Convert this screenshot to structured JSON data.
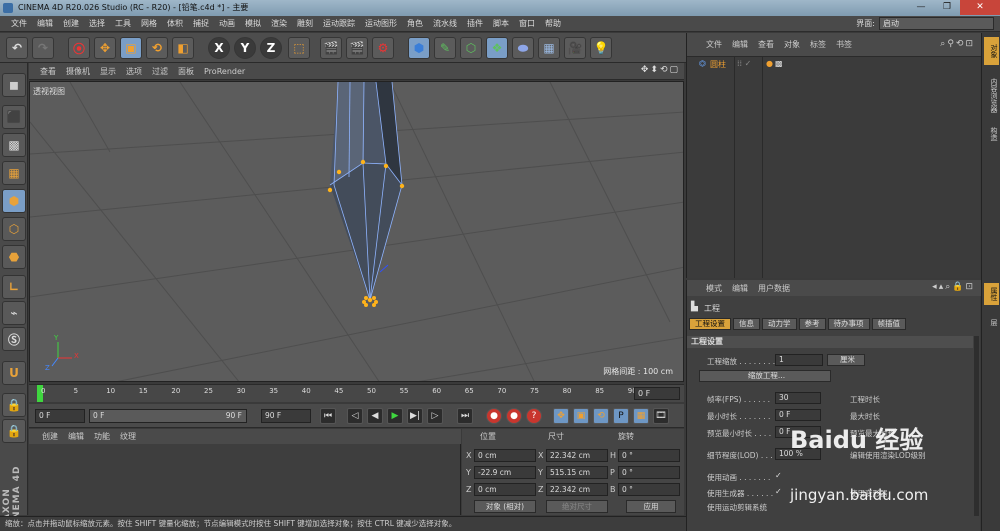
{
  "window": {
    "title": "CINEMA 4D R20.026 Studio (RC - R20) - [铅笔.c4d *] - 主要",
    "controls": [
      "—",
      "❐",
      "✕"
    ]
  },
  "menubar": [
    "文件",
    "编辑",
    "创建",
    "选择",
    "工具",
    "网格",
    "体积",
    "捕捉",
    "动画",
    "模拟",
    "渲染",
    "雕刻",
    "运动跟踪",
    "运动图形",
    "角色",
    "流水线",
    "插件",
    "脚本",
    "窗口",
    "帮助"
  ],
  "layout": {
    "label": "界面:",
    "value": "启动"
  },
  "toolbar_icons": [
    "undo-icon",
    "redo-icon",
    "live-select-icon",
    "move-icon",
    "scale-icon",
    "rotate-icon",
    "recent-tool-icon",
    "x-axis-icon",
    "y-axis-icon",
    "z-axis-icon",
    "coordinate-system-icon",
    "render-view-icon",
    "render-picture-queue-icon",
    "edit-render-settings-icon",
    "cube-icon",
    "pen-icon",
    "subdivision-icon",
    "array-icon",
    "deformer-icon",
    "floor-icon",
    "camera-icon",
    "light-icon"
  ],
  "toolbar_labels": {
    "x": "X",
    "y": "Y",
    "z": "Z"
  },
  "viewport": {
    "menu": [
      "查看",
      "摄像机",
      "显示",
      "选项",
      "过滤",
      "面板",
      "ProRender"
    ],
    "nav_icons": "✥⬍⟲▢",
    "label": "透视视图",
    "grid_spacing": "网格间距 : 100 cm",
    "axes": {
      "x": "X",
      "y": "Y",
      "z": "Z"
    }
  },
  "timeline": {
    "ticks": [
      "0",
      "5",
      "10",
      "15",
      "20",
      "25",
      "30",
      "35",
      "40",
      "45",
      "50",
      "55",
      "60",
      "65",
      "70",
      "75",
      "80",
      "85",
      "90"
    ],
    "current_frame": "0 F"
  },
  "transport": {
    "start": "0 F",
    "range_start": "0 F",
    "range_end": "90 F",
    "end": "90 F",
    "buttons": {
      "first": "⏮",
      "prev_key": "◁",
      "prev": "◀",
      "play": "▶",
      "next": "▶|",
      "next_key": "▷",
      "last": "⏭",
      "record": "●",
      "auto_key": "●",
      "key_sel": "?",
      "pos": "✥",
      "scale": "▣",
      "rot": "⟲",
      "param": "P",
      "grid": "▦",
      "film": "🎞"
    }
  },
  "material_manager": {
    "menu": [
      "创建",
      "编辑",
      "功能",
      "纹理"
    ]
  },
  "coordinates": {
    "headers": [
      "位置",
      "尺寸",
      "旋转"
    ],
    "rows": [
      {
        "pos_label": "X",
        "pos": "0 cm",
        "size_label": "X",
        "size": "22.342 cm",
        "rot_label": "H",
        "rot": "0 °"
      },
      {
        "pos_label": "Y",
        "pos": "-22.9 cm",
        "size_label": "Y",
        "size": "515.15 cm",
        "rot_label": "P",
        "rot": "0 °"
      },
      {
        "pos_label": "Z",
        "pos": "0 cm",
        "size_label": "Z",
        "size": "22.342 cm",
        "rot_label": "B",
        "rot": "0 °"
      }
    ],
    "mode": "对象 (相对)",
    "size_mode": "绝对尺寸",
    "apply": "应用"
  },
  "object_manager": {
    "menu": [
      "文件",
      "编辑",
      "查看",
      "对象",
      "标签",
      "书签"
    ],
    "objects": [
      {
        "name": "圆柱"
      }
    ]
  },
  "attribute_manager": {
    "menu": [
      "模式",
      "编辑",
      "用户数据"
    ],
    "object_label": "工程",
    "tabs": [
      "工程设置",
      "信息",
      "动力学",
      "参考",
      "待办事项",
      "帧插值"
    ],
    "section": "工程设置",
    "fields": {
      "scale_label": "工程缩放 . . . . . . . .",
      "scale_value": "1",
      "scale_unit": "厘米",
      "scale_button": "缩放工程...",
      "fps_label": "帧率(FPS) . . . . . .",
      "fps_value": "30",
      "duration_label": "工程时长",
      "min_label": "最小时长 . . . . . . .",
      "min_value": "0 F",
      "max_label": "最大时长",
      "preview_min_label": "预览最小时长 . . . .",
      "preview_min_value": "0 F",
      "preview_max_label": "预览最大时长",
      "lod_label": "细节程度(LOD) . . . .",
      "lod_value": "100 %",
      "lod_render_label": "编辑使用渲染LOD级别",
      "anim_label": "使用动画 . . . . . . .",
      "gen_label": "使用生成器 . . . . . .",
      "deform_label": "使用变形器",
      "motion_label": "使用运动剪辑系统"
    }
  },
  "right_strip": [
    "对象",
    "内容浏览器",
    "构造",
    "属性",
    "层"
  ],
  "status": "缩放：点击并拖动鼠标缩放元素。按住 SHIFT 键量化缩放；节点编辑模式时按住 SHIFT 键增加选择对象；按住 CTRL 键减少选择对象。",
  "watermark": {
    "brand": "Baidu 经验",
    "url": "jingyan.baidu.com"
  },
  "colors": {
    "accent": "#d9a23a",
    "active_blue": "#7a9ec7",
    "play_green": "#3fd63f"
  }
}
